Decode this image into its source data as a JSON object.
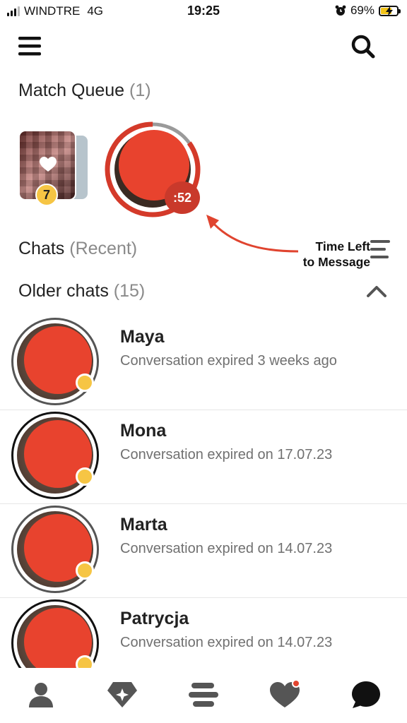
{
  "status_bar": {
    "carrier": "WINDTRE",
    "network": "4G",
    "time": "19:25",
    "battery_percent": "69%",
    "battery_level": 0.69,
    "icons": [
      "signal-icon",
      "alarm-icon",
      "battery-charging-icon"
    ]
  },
  "top_bar": {
    "icons": [
      "menu-icon",
      "search-icon"
    ]
  },
  "match_queue": {
    "title": "Match Queue",
    "count": "(1)",
    "queue_badge": "7",
    "timer_label": ":52",
    "timer_progress": 0.85
  },
  "annotation": {
    "line1": "Time Left",
    "line2": "to Message"
  },
  "chats": {
    "title": "Chats",
    "subtitle": "(Recent)"
  },
  "older_chats": {
    "title": "Older chats",
    "count": "(15)",
    "items": [
      {
        "name": "Maya",
        "status": "Conversation expired 3 weeks ago"
      },
      {
        "name": "Mona",
        "status": "Conversation expired on 17.07.23"
      },
      {
        "name": "Marta",
        "status": "Conversation expired on 14.07.23"
      },
      {
        "name": "Patrycja",
        "status": "Conversation expired on 14.07.23"
      }
    ]
  },
  "bottom_nav": {
    "items": [
      "profile-icon",
      "diamond-icon",
      "discover-icon",
      "likes-icon",
      "chat-icon"
    ]
  },
  "colors": {
    "accent": "#e8432e",
    "badge_yellow": "#f6c544",
    "icon_gray": "#555555"
  }
}
